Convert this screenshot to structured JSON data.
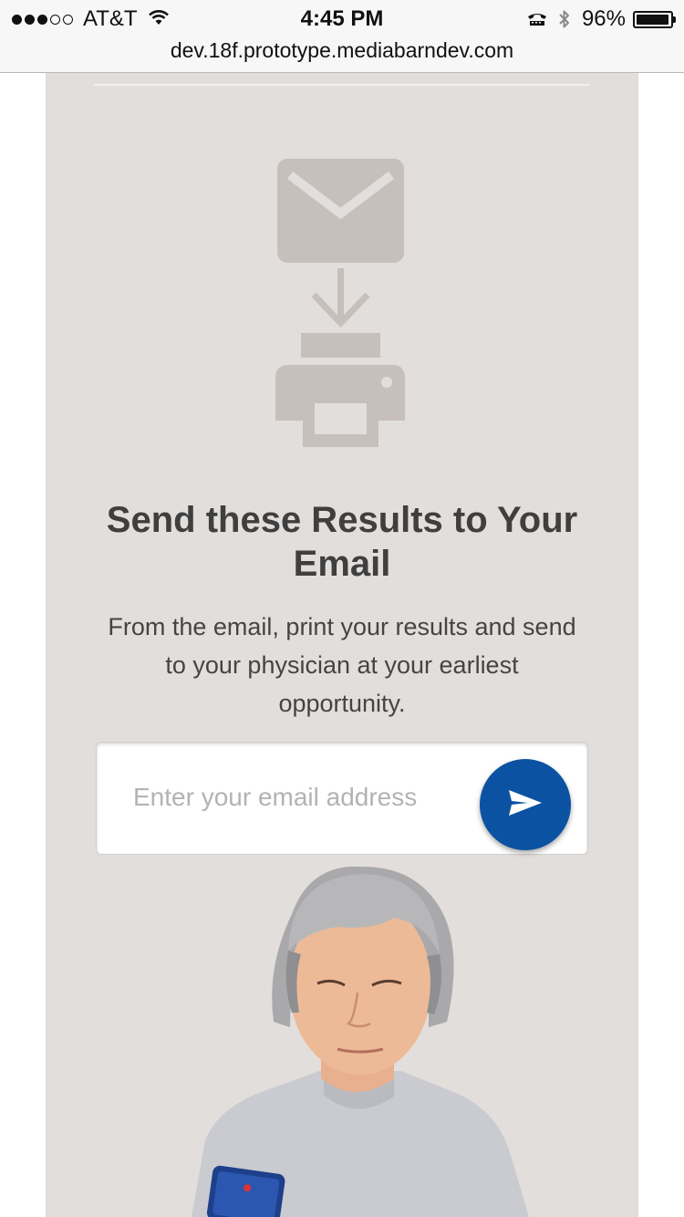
{
  "status_bar": {
    "signal_filled": 3,
    "signal_total": 5,
    "carrier": "AT&T",
    "time": "4:45 PM",
    "battery_percent": "96%",
    "battery_level": 0.96,
    "icons": [
      "wifi-icon",
      "tty-icon",
      "bluetooth-icon",
      "battery-icon"
    ]
  },
  "browser": {
    "url": "dev.18f.prototype.mediabarndev.com"
  },
  "main": {
    "illustration_icons": [
      "envelope-icon",
      "arrow-down-icon",
      "printer-icon"
    ],
    "heading": "Send these Results to Your Email",
    "description": "From the email, print your results and send to your physician at your earliest opportunity.",
    "email_form": {
      "placeholder": "Enter your email address",
      "value": "",
      "submit_icon": "send-icon"
    }
  },
  "colors": {
    "panel_background": "#e2dedb",
    "icon_gray": "#c6bfbc",
    "heading_text": "#3f3f3f",
    "accent_blue": "#0b52a2"
  }
}
